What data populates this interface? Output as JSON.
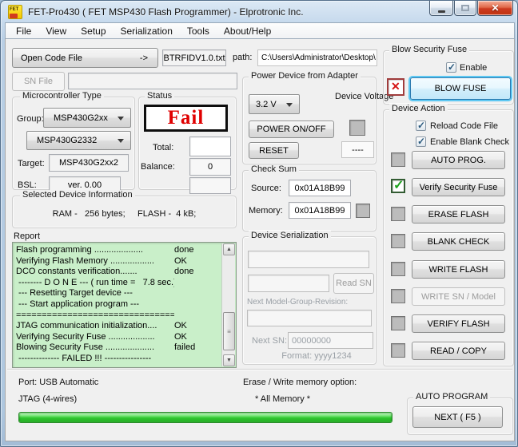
{
  "window": {
    "title": "FET-Pro430  ( FET MSP430 Flash Programmer)  -  Elprotronic Inc.",
    "icon_text": "FET"
  },
  "icons": {
    "combo_arrow": "▼",
    "checkmark": "✓",
    "cross": "✕",
    "scroll_up": "▲",
    "scroll_down": "▼",
    "scroll_grip": "≡",
    "open_arrow": "->"
  },
  "menu": {
    "items": [
      "File",
      "View",
      "Setup",
      "Serialization",
      "Tools",
      "About/Help"
    ]
  },
  "file_row": {
    "open_button": "Open Code File",
    "open_arrow": "->",
    "code_file": "BTRFIDV1.0.txt",
    "path_label": "path:",
    "path_value": "C:\\Users\\Administrator\\Desktop\\",
    "sn_file_button": "SN File",
    "sn_file_value": ""
  },
  "mcu": {
    "group_title": "Microcontroller Type",
    "group_label": "Group:",
    "group_value": "MSP430G2xx",
    "model_value": "MSP430G2332",
    "target_label": "Target:",
    "target_value": "MSP430G2xx2",
    "bsl_label": "BSL:",
    "bsl_value": "ver.  0.00"
  },
  "status": {
    "group_title": "Status",
    "value": "Fail",
    "total_label": "Total:",
    "total_value": "",
    "balance_label": "Balance:",
    "balance_value": "0",
    "extra_value": ""
  },
  "device_info": {
    "group_title": "Selected Device Information",
    "value": "RAM -   256 bytes;     FLASH -  4 kB;"
  },
  "report": {
    "title": "Report",
    "lines": [
      {
        "text": "Flash programming ....................",
        "result": "done"
      },
      {
        "text": "Verifying Flash Memory ..................",
        "result": "OK"
      },
      {
        "text": "DCO constants verification.......",
        "result": "done"
      },
      {
        "text": " -------- D O N E --- ( run time =   7.8 sec.)",
        "result": ""
      },
      {
        "text": " --- Resetting Target device ---",
        "result": ""
      },
      {
        "text": " --- Start application program ---",
        "result": ""
      },
      {
        "text": "======================================",
        "result": ""
      },
      {
        "text": "JTAG communication initialization....",
        "result": "OK"
      },
      {
        "text": "Verifying Security Fuse ...................",
        "result": "OK"
      },
      {
        "text": "Blowing Security Fuse ....................",
        "result": "failed"
      },
      {
        "text": " -------------- FAILED !!! ----------------",
        "result": ""
      }
    ]
  },
  "power": {
    "group_title": "Power Device from Adapter",
    "voltage_value": "3.2 V",
    "device_voltage_label": "Device Voltage",
    "power_button": "POWER ON/OFF",
    "reset_button": "RESET",
    "voltage_reading": "----"
  },
  "checksum": {
    "group_title": "Check Sum",
    "source_label": "Source:",
    "source_value": "0x01A18B99",
    "memory_label": "Memory:",
    "memory_value": "0x01A18B99"
  },
  "serialization": {
    "group_title": "Device Serialization",
    "field1": "",
    "field2": "",
    "read_sn_button": "Read SN",
    "next_model_label": "Next Model-Group-Revision:",
    "next_model_value": "",
    "next_sn_label": "Next SN:",
    "next_sn_value": "00000000",
    "format_label": "Format: yyyy1234"
  },
  "blow_fuse": {
    "group_title": "Blow Security Fuse",
    "enable_label": "Enable",
    "enable_checked": true,
    "button": "BLOW FUSE"
  },
  "device_action": {
    "group_title": "Device Action",
    "reload_label": "Reload Code File",
    "reload_checked": true,
    "blank_check_label": "Enable Blank Check",
    "blank_check_checked": true,
    "actions": [
      {
        "label": "AUTO PROG.",
        "indicator": "gray",
        "enabled": true
      },
      {
        "label": "Verify Security Fuse",
        "indicator": "green-check",
        "enabled": true
      },
      {
        "label": "ERASE FLASH",
        "indicator": "gray",
        "enabled": true
      },
      {
        "label": "BLANK CHECK",
        "indicator": "gray",
        "enabled": true
      },
      {
        "label": "WRITE FLASH",
        "indicator": "gray",
        "enabled": true
      },
      {
        "label": "WRITE SN / Model",
        "indicator": "gray",
        "enabled": false
      },
      {
        "label": "VERIFY FLASH",
        "indicator": "gray",
        "enabled": true
      },
      {
        "label": "READ / COPY",
        "indicator": "gray",
        "enabled": true
      }
    ]
  },
  "footer": {
    "port": "Port: USB Automatic",
    "jtag": "JTAG (4-wires)",
    "erase_option_label": "Erase / Write memory option:",
    "erase_option_value": "* All Memory *",
    "auto_program_title": "AUTO PROGRAM",
    "next_button": "NEXT   ( F5 )",
    "progress_percent": 100
  },
  "colors": {
    "fail_red": "#e00000",
    "report_bg": "#c9efc9",
    "progress_green": "#2fc72f",
    "focus_ring_cyan": "#5fc8f2",
    "indicator_check_green": "#1ca31c",
    "indicator_cross_red": "#d41414",
    "titlebar_blue": "#c7daed",
    "content_gray": "#f0f0f0"
  }
}
